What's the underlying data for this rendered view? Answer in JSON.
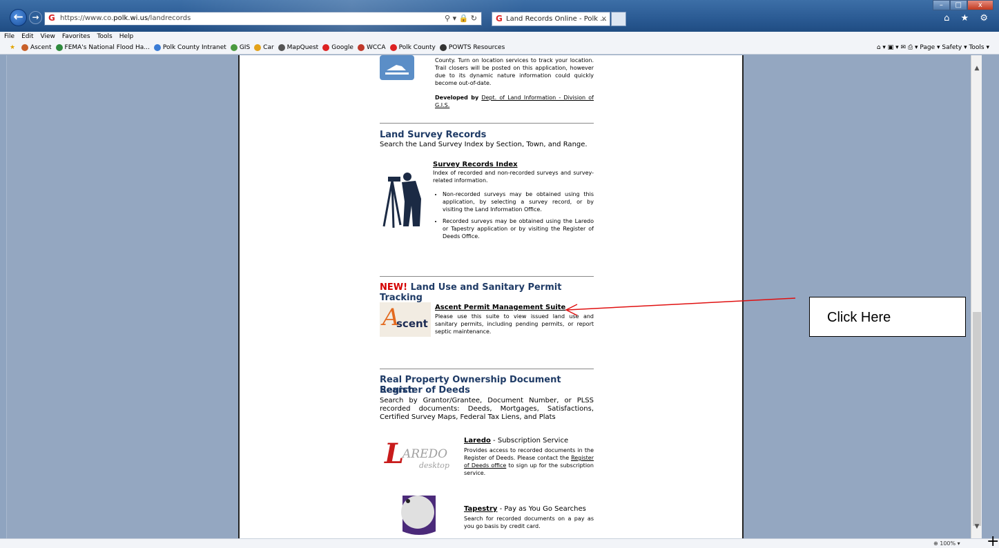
{
  "browser": {
    "url_prefix": "https://www.co.",
    "url_domain": "polk.wi.us",
    "url_path": "/landrecords",
    "addr_tools": "⚲ ▾ 🔒 ↻",
    "tab_title": "Land Records Online - Polk ...",
    "tab_close": "×",
    "window_min": "–",
    "window_max": "□",
    "window_close": "x",
    "home_star_gear": "⌂ ★ ⚙",
    "menu": [
      "File",
      "Edit",
      "View",
      "Favorites",
      "Tools",
      "Help"
    ],
    "favorites": [
      {
        "label": "Ascent",
        "color": "#c8602a"
      },
      {
        "label": "FEMA's National Flood Ha...",
        "color": "#2f8a3d"
      },
      {
        "label": "Polk County Intranet",
        "color": "#3a7bd5"
      },
      {
        "label": "GIS",
        "color": "#4a9a3f"
      },
      {
        "label": "Car",
        "color": "#e3a21a"
      },
      {
        "label": "MapQuest",
        "color": "#555555"
      },
      {
        "label": "Google",
        "color": "#dd2222"
      },
      {
        "label": "WCCA",
        "color": "#c0392b"
      },
      {
        "label": "Polk County",
        "color": "#dd2222"
      },
      {
        "label": "POWTS Resources",
        "color": "#333333"
      }
    ],
    "command_bar": "Page ▾  Safety ▾  Tools ▾",
    "zoom": "100%",
    "zoom_arrow": "▾"
  },
  "content": {
    "trail_text": "County. Turn on location services to track your location. Trail closers will be posted on this application, however due to its dynamic nature information could quickly become out-of-date.",
    "developed_by": "Developed by",
    "developed_link": "Dept. of Land Information - Division of G.I.S.",
    "survey_heading": "Land Survey Records",
    "survey_sub": "Search the Land Survey Index by Section, Town, and Range.",
    "survey_link": "Survey Records Index",
    "survey_desc": "Index of recorded and non-recorded surveys and survey-related information.",
    "survey_bullets": [
      "Non-recorded surveys may be obtained using this application, by selecting a survey record, or by visiting the Land Information Office.",
      "Recorded surveys may be obtained using the Laredo or Tapestry application or by visiting the Register of Deeds Office."
    ],
    "new_label": "NEW!",
    "landuse_heading": "Land Use and Sanitary Permit Tracking",
    "ascent_logo": "scent",
    "ascent_link": "Ascent Permit Management Suite",
    "ascent_desc": "Please use this suite to view issued land use and sanitary permits, including pending permits, or report septic maintenance.",
    "rp_heading_1": "Real Property Ownership Document Search",
    "rp_heading_2": "Register of Deeds",
    "rp_sub": "Search by Grantor/Grantee, Document Number, or PLSS recorded documents: Deeds, Mortgages, Satisfactions, Certified Survey Maps, Federal Tax Liens, and Plats",
    "laredo_logo_1": "AREDO",
    "laredo_logo_2": "desktop",
    "laredo_link": "Laredo",
    "laredo_suffix": " - Subscription Service",
    "laredo_desc_1": "Provides access to recorded documents in the Register of Deeds. Please contact the ",
    "laredo_desc_link": "Register of Deeds office",
    "laredo_desc_2": " to sign up for the subscription service.",
    "tapestry_link": "Tapestry",
    "tapestry_suffix": " - Pay as You Go Searches",
    "tapestry_desc": "Search for recorded documents on a pay as you go basis by credit card."
  },
  "annotation": {
    "callout": "Click Here",
    "plus": "+"
  }
}
